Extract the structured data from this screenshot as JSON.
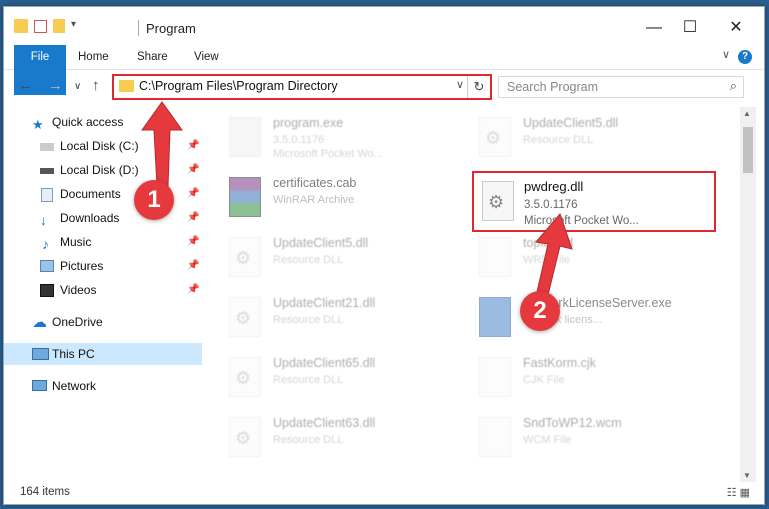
{
  "window": {
    "title": "Program"
  },
  "ribbon": {
    "tabs": [
      "File",
      "Home",
      "Share",
      "View"
    ]
  },
  "nav": {
    "address": "C:\\Program Files\\Program Directory",
    "search_placeholder": "Search Program"
  },
  "sidebar": {
    "items": [
      {
        "label": "Quick access"
      },
      {
        "label": "Local Disk (C:)"
      },
      {
        "label": "Local Disk (D:)"
      },
      {
        "label": "Documents"
      },
      {
        "label": "Downloads"
      },
      {
        "label": "Music"
      },
      {
        "label": "Pictures"
      },
      {
        "label": "Videos"
      },
      {
        "label": "OneDrive"
      },
      {
        "label": "This PC"
      },
      {
        "label": "Network"
      }
    ]
  },
  "files": [
    {
      "name": "program.exe",
      "line1": "3.5.0.1176",
      "line2": "Microsoft Pocket Wo..."
    },
    {
      "name": "UpdateClient5.dll",
      "line1": "Resource DLL",
      "line2": ""
    },
    {
      "name": "certificates.cab",
      "line1": "WinRAR Archive",
      "line2": ""
    },
    {
      "name": "UpdateClient5.dll",
      "line1": "Resource DLL",
      "line2": ""
    },
    {
      "name": "topic.wrd",
      "line1": "WRD File",
      "line2": ""
    },
    {
      "name": "UpdateClient21.dll",
      "line1": "Resource DLL",
      "line2": ""
    },
    {
      "name": "NetworkLicenseServer.exe",
      "line1": "network licens...",
      "line2": ""
    },
    {
      "name": "UpdateClient65.dll",
      "line1": "Resource DLL",
      "line2": ""
    },
    {
      "name": "FastKorm.cjk",
      "line1": "CJK File",
      "line2": ""
    },
    {
      "name": "UpdateClient63.dll",
      "line1": "Resource DLL",
      "line2": ""
    },
    {
      "name": "SndToWP12.wcm",
      "line1": "WCM File",
      "line2": ""
    }
  ],
  "highlight": {
    "name": "pwdreg.dll",
    "line1": "3.5.0.1176",
    "line2": "Microsoft Pocket Wo..."
  },
  "status": {
    "count": "164 items"
  },
  "badges": {
    "one": "1",
    "two": "2"
  },
  "colors": {
    "accent": "#1979ca",
    "highlight": "#e0282e",
    "badge": "#e5393e"
  }
}
